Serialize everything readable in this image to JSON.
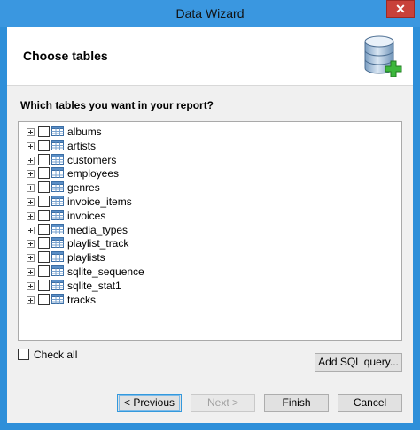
{
  "window": {
    "title": "Data Wizard"
  },
  "header": {
    "title": "Choose tables"
  },
  "prompt": "Which tables you want in your report?",
  "tables": [
    {
      "label": "albums"
    },
    {
      "label": "artists"
    },
    {
      "label": "customers"
    },
    {
      "label": "employees"
    },
    {
      "label": "genres"
    },
    {
      "label": "invoice_items"
    },
    {
      "label": "invoices"
    },
    {
      "label": "media_types"
    },
    {
      "label": "playlist_track"
    },
    {
      "label": "playlists"
    },
    {
      "label": "sqlite_sequence"
    },
    {
      "label": "sqlite_stat1"
    },
    {
      "label": "tracks"
    }
  ],
  "check_all": {
    "label": "Check all"
  },
  "buttons": {
    "add_sql": "Add SQL query...",
    "previous": "< Previous",
    "next": "Next >",
    "finish": "Finish",
    "cancel": "Cancel"
  },
  "colors": {
    "title_bar": "#3a97e0",
    "close_button": "#c8413a",
    "dialog_bg": "#f0f0f0"
  }
}
